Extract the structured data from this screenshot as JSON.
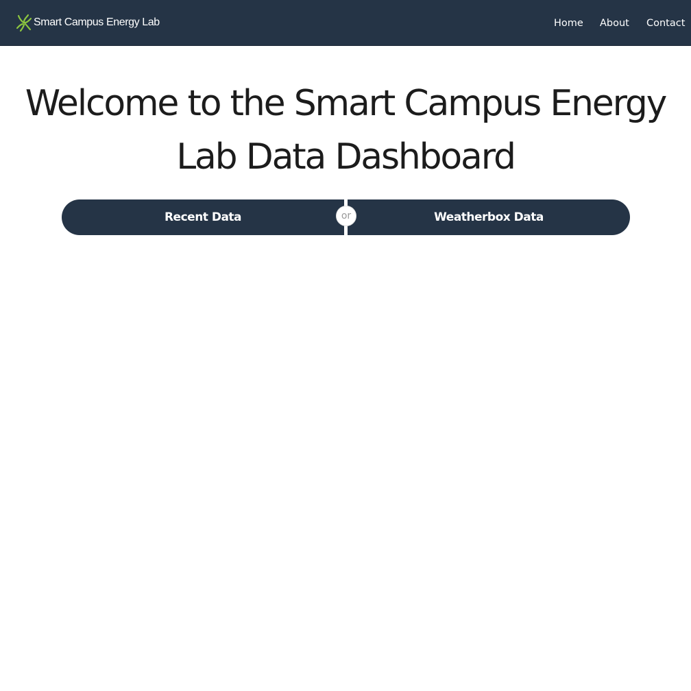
{
  "navbar": {
    "brand": {
      "logo_icon": "pinwheel-leaf-icon",
      "title": "Smart Campus Energy Lab"
    },
    "links": [
      {
        "label": "Home"
      },
      {
        "label": "About"
      },
      {
        "label": "Contact"
      }
    ]
  },
  "hero": {
    "title": "Welcome to the Smart Campus Energy Lab Data Dashboard"
  },
  "actions": {
    "recent_label": "Recent Data",
    "divider_label": "or",
    "weather_label": "Weatherbox Data"
  },
  "colors": {
    "navbar_bg": "#253446",
    "button_bg": "#253446",
    "logo_green": "#8cc63f",
    "text_dark": "#1c1c1c",
    "page_bg": "#ffffff"
  }
}
